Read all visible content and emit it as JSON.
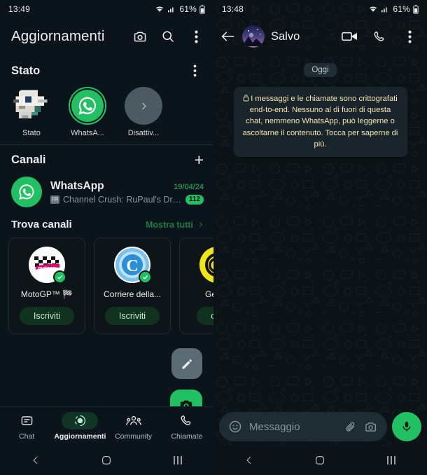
{
  "colors": {
    "brand_green": "#21c063",
    "panel_bg": "#0b141b",
    "chat_bg": "#0c1317",
    "bubble_bg": "#19242b",
    "encryption_text": "#f5e6b3",
    "link_green": "#1d7a45",
    "muted_text": "#8696a0"
  },
  "left_panel": {
    "status_bar": {
      "clock": "13:49",
      "battery": "61%",
      "wifi_icon": "wifi-icon",
      "signal_icon": "signal-icon",
      "battery_icon": "battery-icon"
    },
    "app_bar": {
      "title": "Aggiornamenti",
      "camera_icon": "camera-icon",
      "search_icon": "search-icon",
      "overflow_icon": "more-vertical-icon"
    },
    "status_section": {
      "heading": "Stato",
      "overflow_icon": "more-vertical-icon",
      "items": [
        {
          "label": "Stato",
          "type": "photo"
        },
        {
          "label": "WhatsA...",
          "type": "whatsapp-ring"
        },
        {
          "label": "Disattiv...",
          "type": "muted-chevron"
        }
      ]
    },
    "channels_section": {
      "heading": "Canali",
      "add_icon": "plus-icon",
      "channel": {
        "name": "WhatsApp",
        "date": "19/04/24",
        "preview": "Channel Crush: RuPaul's Drag...",
        "unread_count": "112"
      }
    },
    "find_channels": {
      "heading": "Trova canali",
      "show_all_label": "Mostra tutti",
      "chevron_icon": "chevron-right-icon",
      "cards": [
        {
          "name": "MotoGP™ 🏁",
          "button": "Iscriviti",
          "verified": true,
          "avatar": "motogp-logo"
        },
        {
          "name": "Corriere della...",
          "button": "Iscriviti",
          "verified": true,
          "avatar": "corriere-logo"
        },
        {
          "name": "Geopo",
          "button": "criv",
          "verified": true,
          "avatar": "geopop-logo"
        }
      ]
    },
    "fabs": {
      "edit_icon": "pencil-icon",
      "camera_icon": "camera-icon"
    },
    "tabs": [
      {
        "label": "Chat",
        "icon": "chat-icon",
        "active": false
      },
      {
        "label": "Aggiornamenti",
        "icon": "updates-icon",
        "active": true
      },
      {
        "label": "Community",
        "icon": "community-icon",
        "active": false
      },
      {
        "label": "Chiamate",
        "icon": "calls-icon",
        "active": false
      }
    ],
    "system_nav": {
      "back_icon": "nav-back-icon",
      "home_icon": "nav-home-icon",
      "recents_icon": "nav-recents-icon"
    }
  },
  "right_panel": {
    "status_bar": {
      "clock": "13:48",
      "battery": "61%",
      "wifi_icon": "wifi-icon",
      "signal_icon": "signal-icon",
      "battery_icon": "battery-icon"
    },
    "app_bar": {
      "back_icon": "arrow-back-icon",
      "contact_name": "Salvo",
      "video_call_icon": "video-camera-icon",
      "voice_call_icon": "phone-icon",
      "overflow_icon": "more-vertical-icon"
    },
    "conversation": {
      "day_chip": "Oggi",
      "encryption_notice": "I messaggi e le chiamate sono crittografati end-to-end. Nessuno al di fuori di questa chat, nemmeno WhatsApp, può leggerne o ascoltarne il contenuto. Tocca per saperne di più.",
      "lock_icon": "lock-icon"
    },
    "composer": {
      "emoji_icon": "emoji-icon",
      "placeholder": "Messaggio",
      "attach_icon": "paperclip-icon",
      "camera_icon": "camera-icon",
      "mic_icon": "microphone-icon"
    },
    "system_nav": {
      "back_icon": "nav-back-icon",
      "home_icon": "nav-home-icon",
      "recents_icon": "nav-recents-icon"
    }
  }
}
